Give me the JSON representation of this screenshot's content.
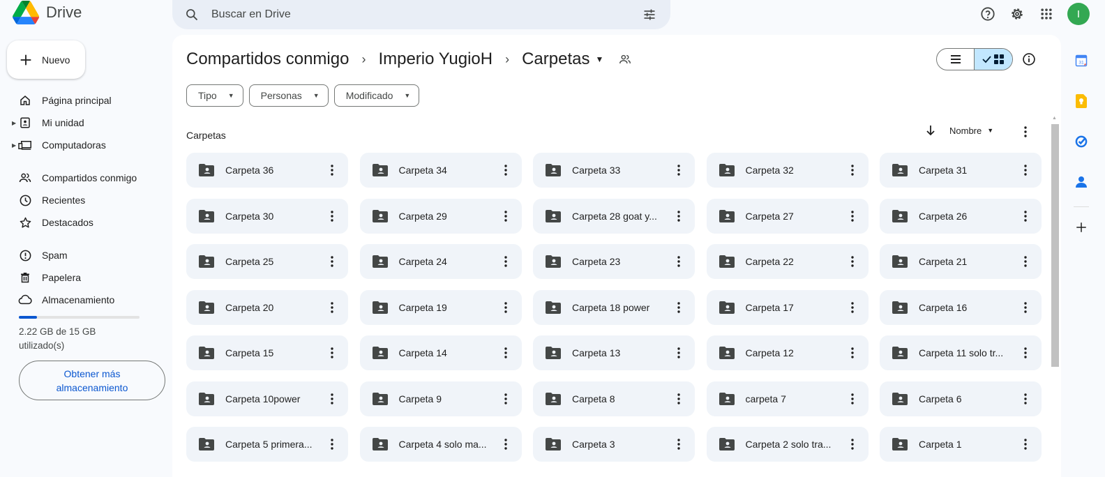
{
  "app": {
    "name": "Drive"
  },
  "search": {
    "placeholder": "Buscar en Drive"
  },
  "header_icons": [
    "help-icon",
    "settings-icon",
    "apps-grid-icon"
  ],
  "account": {
    "initial": "I",
    "color": "#33a852"
  },
  "new_button": {
    "label": "Nuevo"
  },
  "sidebar": {
    "items": [
      {
        "label": "Página principal",
        "icon": "home-icon",
        "expandable": false
      },
      {
        "label": "Mi unidad",
        "icon": "my-drive-icon",
        "expandable": true
      },
      {
        "label": "Computadoras",
        "icon": "computers-icon",
        "expandable": true
      },
      {
        "label": "Compartidos conmigo",
        "icon": "shared-icon",
        "expandable": false
      },
      {
        "label": "Recientes",
        "icon": "clock-icon",
        "expandable": false
      },
      {
        "label": "Destacados",
        "icon": "star-icon",
        "expandable": false
      },
      {
        "label": "Spam",
        "icon": "spam-icon",
        "expandable": false
      },
      {
        "label": "Papelera",
        "icon": "trash-icon",
        "expandable": false
      },
      {
        "label": "Almacenamiento",
        "icon": "cloud-icon",
        "expandable": false
      }
    ],
    "storage": {
      "used_text": "2.22 GB de 15 GB utilizado(s)",
      "used_fraction": 0.148
    },
    "get_more": "Obtener más almacenamiento"
  },
  "breadcrumb": [
    {
      "label": "Compartidos conmigo"
    },
    {
      "label": "Imperio YugioH"
    },
    {
      "label": "Carpetas"
    }
  ],
  "filters": [
    "Tipo",
    "Personas",
    "Modificado"
  ],
  "section": {
    "title": "Carpetas"
  },
  "sort": {
    "label": "Nombre"
  },
  "folders": [
    "Carpeta 36",
    "Carpeta 34",
    "Carpeta 33",
    "Carpeta 32",
    "Carpeta 31",
    "Carpeta 30",
    "Carpeta 29",
    "Carpeta 28 goat y...",
    "Carpeta 27",
    "Carpeta 26",
    "Carpeta 25",
    "Carpeta 24",
    "Carpeta 23",
    "Carpeta 22",
    "Carpeta 21",
    "Carpeta 20",
    "Carpeta 19",
    "Carpeta 18 power",
    "Carpeta 17",
    "Carpeta 16",
    "Carpeta 15",
    "Carpeta 14",
    "Carpeta 13",
    "Carpeta 12",
    "Carpeta 11 solo tr...",
    "Carpeta 10power",
    "Carpeta 9",
    "Carpeta 8",
    "carpeta 7",
    "Carpeta 6",
    "Carpeta 5 primera...",
    "Carpeta 4 solo ma...",
    "Carpeta 3",
    "Carpeta 2 solo tra...",
    "Carpeta 1"
  ],
  "right_rail": [
    "calendar-icon",
    "keep-icon",
    "tasks-icon",
    "contacts-icon",
    "add-icon"
  ],
  "colors": {
    "accent": "#0b57d0",
    "card_bg": "#f0f4f9",
    "toggle_selected": "#c2e7ff"
  }
}
